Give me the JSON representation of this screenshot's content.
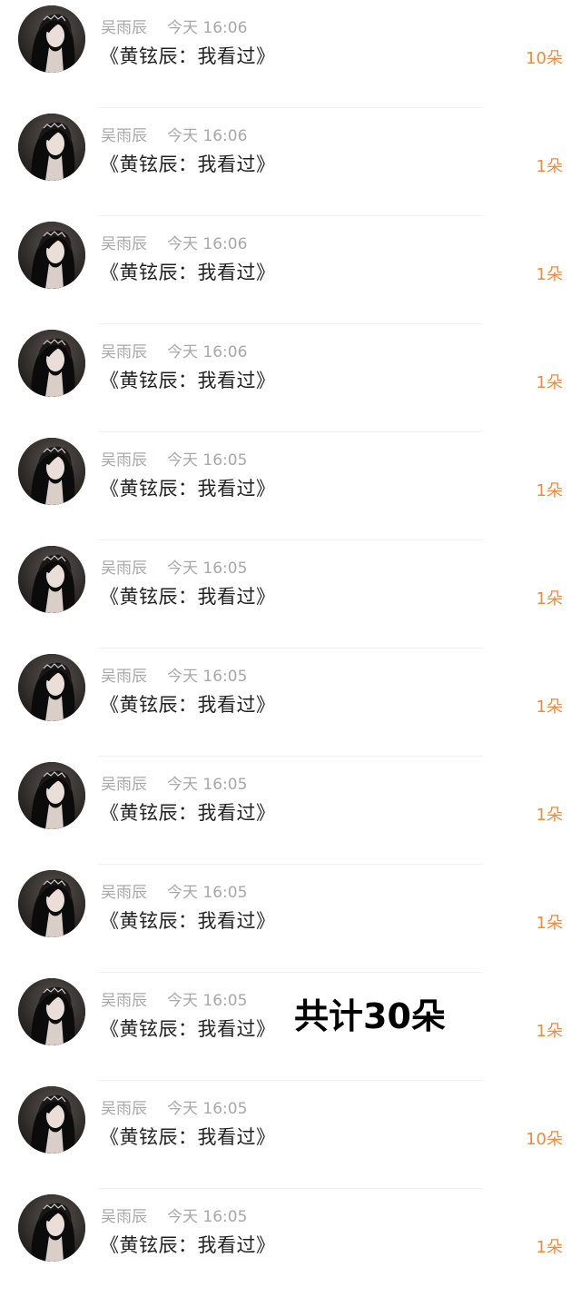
{
  "records": [
    {
      "user": "吴雨辰",
      "time": "今天 16:06",
      "title": "《黄铉辰：我看过》",
      "amount": "10朵"
    },
    {
      "user": "吴雨辰",
      "time": "今天 16:06",
      "title": "《黄铉辰：我看过》",
      "amount": "1朵"
    },
    {
      "user": "吴雨辰",
      "time": "今天 16:06",
      "title": "《黄铉辰：我看过》",
      "amount": "1朵"
    },
    {
      "user": "吴雨辰",
      "time": "今天 16:06",
      "title": "《黄铉辰：我看过》",
      "amount": "1朵"
    },
    {
      "user": "吴雨辰",
      "time": "今天 16:05",
      "title": "《黄铉辰：我看过》",
      "amount": "1朵"
    },
    {
      "user": "吴雨辰",
      "time": "今天 16:05",
      "title": "《黄铉辰：我看过》",
      "amount": "1朵"
    },
    {
      "user": "吴雨辰",
      "time": "今天 16:05",
      "title": "《黄铉辰：我看过》",
      "amount": "1朵"
    },
    {
      "user": "吴雨辰",
      "time": "今天 16:05",
      "title": "《黄铉辰：我看过》",
      "amount": "1朵"
    },
    {
      "user": "吴雨辰",
      "time": "今天 16:05",
      "title": "《黄铉辰：我看过》",
      "amount": "1朵"
    },
    {
      "user": "吴雨辰",
      "time": "今天 16:05",
      "title": "《黄铉辰：我看过》",
      "amount": "1朵"
    },
    {
      "user": "吴雨辰",
      "time": "今天 16:05",
      "title": "《黄铉辰：我看过》",
      "amount": "10朵"
    },
    {
      "user": "吴雨辰",
      "time": "今天 16:05",
      "title": "《黄铉辰：我看过》",
      "amount": "1朵"
    }
  ],
  "total_label": "共计30朵",
  "colors": {
    "amount": "#f08a3c",
    "meta": "#a8a8a8",
    "title": "#222222"
  }
}
